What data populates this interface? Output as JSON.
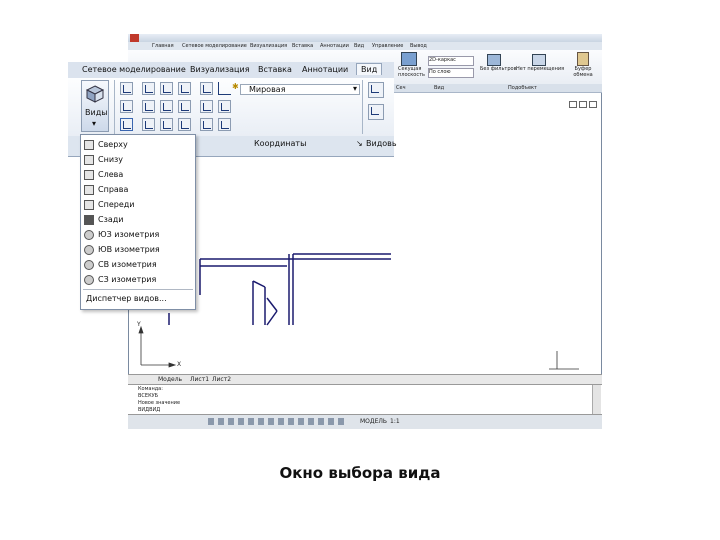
{
  "main_window": {
    "tabs": [
      "Главная",
      "Сетевое моделирование",
      "Визуализация",
      "Вставка",
      "Аннотации",
      "Вид",
      "Управление",
      "Вывод"
    ],
    "ribbon_buttons": [
      "Секущая плоскость",
      "Без фильтров",
      "Нет перемещения",
      "Буфер обмена"
    ],
    "ribbon_group_labels": [
      "Сеч",
      "Вид",
      "Подобъект"
    ],
    "layer_dropdown": "2D-каркас",
    "layer_dropdown2": "По слою",
    "model_tabs": [
      "Модель",
      "Лист1",
      "Лист2"
    ],
    "command_lines": [
      "Команда:",
      "ВСЕКУБ",
      "Новое значение",
      "ВИДВИД"
    ],
    "status_model": "МОДЕЛЬ",
    "status_scale": "1:1",
    "axis_y": "Y",
    "axis_x": "X"
  },
  "front_ribbon": {
    "tabs": [
      "Сетевое моделирование",
      "Визуализация",
      "Вставка",
      "Аннотации",
      "Вид"
    ],
    "active_tab": "Вид",
    "views_button": "Виды",
    "view_dropdown": "Мировая",
    "group_coordinates": "Координаты",
    "group_views": "Видовь"
  },
  "views_dropdown": {
    "items": [
      "Сверху",
      "Снизу",
      "Слева",
      "Справа",
      "Спереди",
      "Сзади",
      "ЮЗ изометрия",
      "ЮВ изометрия",
      "СВ изометрия",
      "СЗ изометрия"
    ],
    "manager": "Диспетчер видов..."
  },
  "caption": "Окно выбора вида",
  "colors": {
    "drawing_line": "#1a1a6e",
    "ribbon_bg": "#e9eef5",
    "accent": "#1d3a78"
  }
}
